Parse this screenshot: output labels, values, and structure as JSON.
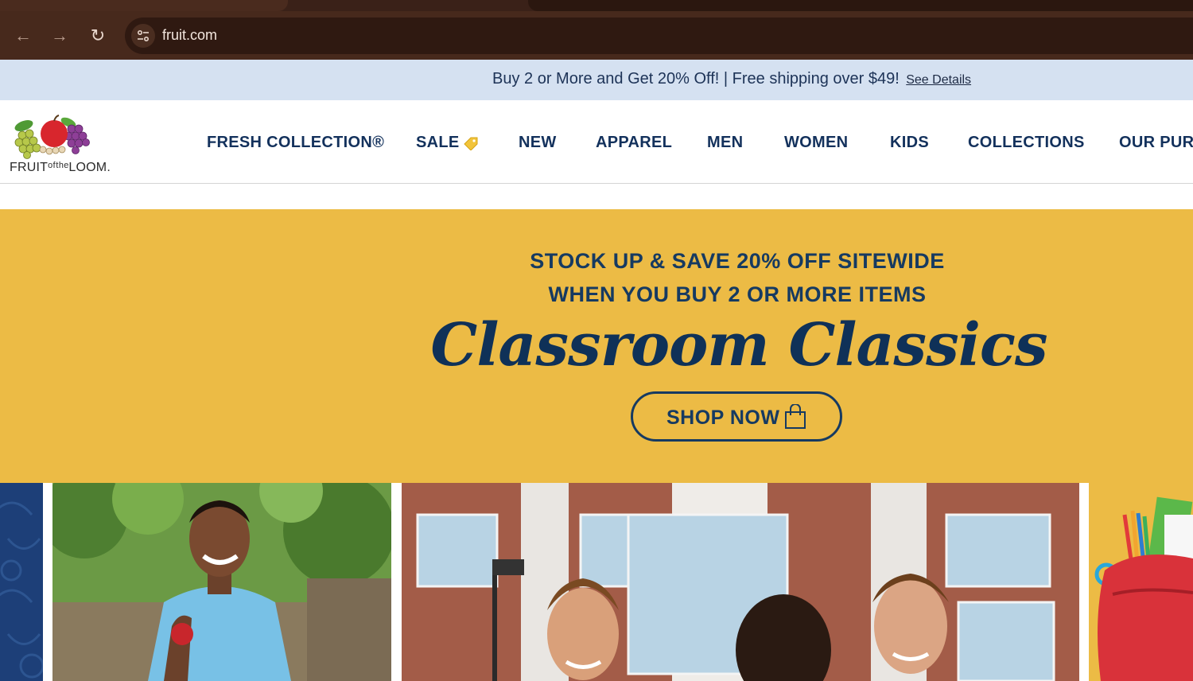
{
  "browser": {
    "url": "fruit.com",
    "icons": {
      "back": "arrow-left-icon",
      "forward": "arrow-right-icon",
      "reload": "reload-icon",
      "site_info": "tune-icon"
    }
  },
  "promo": {
    "text": "Buy 2 or More and Get 20% Off! | Free shipping over $49!",
    "link": "See Details"
  },
  "header": {
    "logo_text": "FRUITᵒᶠᵗʰᵉLOOM.",
    "nav": [
      {
        "label": "FRESH COLLECTION®"
      },
      {
        "label": "SALE"
      },
      {
        "label": "NEW"
      },
      {
        "label": "APPAREL"
      },
      {
        "label": "MEN"
      },
      {
        "label": "WOMEN"
      },
      {
        "label": "KIDS"
      },
      {
        "label": "COLLECTIONS"
      },
      {
        "label": "OUR PURI"
      }
    ]
  },
  "hero": {
    "line1": "STOCK UP & SAVE 20% OFF SITEWIDE",
    "line2": "WHEN YOU BUY 2 OR MORE ITEMS",
    "script_title": "Classroom Classics",
    "cta": "SHOP NOW"
  },
  "colors": {
    "navy": "#13315c",
    "gold": "#ecbb45",
    "promo_bg": "#d5e1f1",
    "chrome": "#47291c"
  }
}
